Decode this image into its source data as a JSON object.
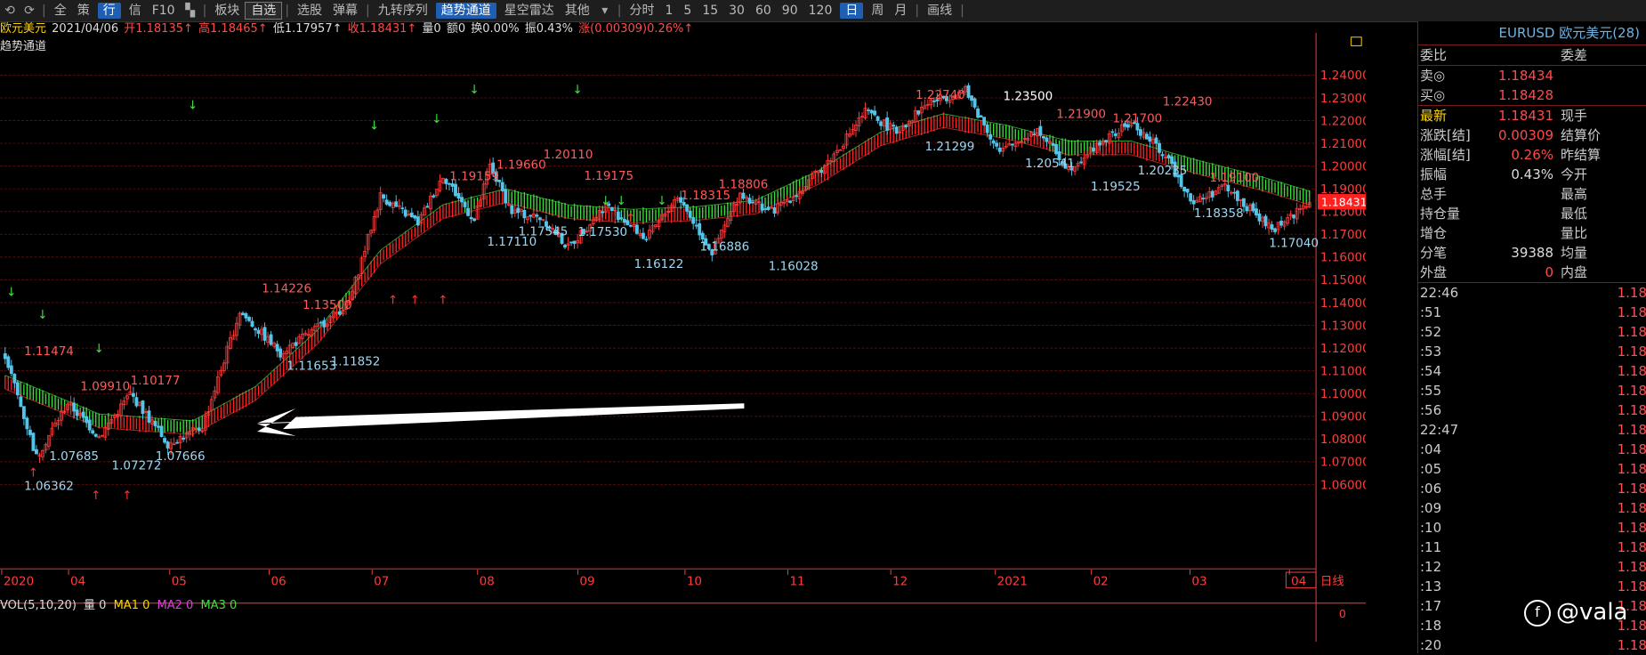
{
  "toolbar": {
    "items": [
      "全",
      "策",
      "行",
      "信",
      "F10",
      "板块",
      "自选",
      "选股",
      "弹幕",
      "九转序列",
      "趋势通道",
      "星空雷达",
      "其他",
      "分时",
      "1",
      "5",
      "15",
      "30",
      "60",
      "90",
      "120",
      "日",
      "周",
      "月",
      "画线"
    ]
  },
  "info": {
    "name": "欧元美元",
    "date": "2021/04/06",
    "open": "开1.18135↑",
    "high": "高1.18465↑",
    "low": "低1.17957↑",
    "close": "收1.18431↑",
    "vol": "量0",
    "amount": "额0",
    "turnover": "换0.00%",
    "amplitude": "振0.43%",
    "change": "涨(0.00309)0.26%↑"
  },
  "indicator_title": "趋势通道",
  "vol_line": {
    "label": "VOL(5,10,20)",
    "vol": "量 0",
    "ma1": "MA1 0",
    "ma2": "MA2 0",
    "ma3": "MA3 0"
  },
  "period_label": "日线",
  "vol_axis_value": "0",
  "colors": {
    "up": "#ff3b3b",
    "down": "#54c4e8",
    "band_up": "#ff2020",
    "band_down": "#38e038",
    "axis": "#ff3b3b",
    "grid": "#5a0d0d",
    "label_blue": "#9fd6f0",
    "label_red": "#ff5a5a"
  },
  "chart_data": {
    "type": "candlestick",
    "symbol": "EURUSD",
    "ylim": [
      1.058,
      1.245
    ],
    "y_ticks": [
      "1.24000",
      "1.23000",
      "1.22000",
      "1.21000",
      "1.20000",
      "1.19000",
      "1.18000",
      "1.17000",
      "1.16000",
      "1.15000",
      "1.14000",
      "1.13000",
      "1.12000",
      "1.11000",
      "1.10000",
      "1.09000",
      "1.08000",
      "1.07000",
      "1.06000"
    ],
    "x_labels": [
      "2020",
      "04",
      "05",
      "06",
      "07",
      "08",
      "09",
      "10",
      "11",
      "12",
      "2021",
      "02",
      "03",
      "04"
    ],
    "last_price": "1.18431",
    "trend_points": [
      [
        0,
        1.117
      ],
      [
        10,
        1.072
      ],
      [
        20,
        1.096
      ],
      [
        30,
        1.081
      ],
      [
        40,
        1.1
      ],
      [
        52,
        1.078
      ],
      [
        63,
        1.085
      ],
      [
        75,
        1.136
      ],
      [
        88,
        1.118
      ],
      [
        100,
        1.129
      ],
      [
        110,
        1.14
      ],
      [
        120,
        1.187
      ],
      [
        132,
        1.175
      ],
      [
        140,
        1.196
      ],
      [
        150,
        1.176
      ],
      [
        155,
        1.2
      ],
      [
        162,
        1.18
      ],
      [
        172,
        1.177
      ],
      [
        180,
        1.164
      ],
      [
        192,
        1.183
      ],
      [
        205,
        1.168
      ],
      [
        215,
        1.187
      ],
      [
        226,
        1.162
      ],
      [
        235,
        1.188
      ],
      [
        245,
        1.18
      ],
      [
        255,
        1.19
      ],
      [
        265,
        1.205
      ],
      [
        275,
        1.224
      ],
      [
        285,
        1.215
      ],
      [
        295,
        1.228
      ],
      [
        307,
        1.233
      ],
      [
        318,
        1.206
      ],
      [
        330,
        1.216
      ],
      [
        340,
        1.199
      ],
      [
        350,
        1.21
      ],
      [
        360,
        1.219
      ],
      [
        370,
        1.206
      ],
      [
        380,
        1.184
      ],
      [
        390,
        1.191
      ],
      [
        405,
        1.172
      ],
      [
        417,
        1.184
      ]
    ],
    "band_points": [
      [
        0,
        1.105
      ],
      [
        30,
        1.088
      ],
      [
        60,
        1.085
      ],
      [
        80,
        1.1
      ],
      [
        100,
        1.125
      ],
      [
        120,
        1.16
      ],
      [
        140,
        1.18
      ],
      [
        160,
        1.187
      ],
      [
        180,
        1.18
      ],
      [
        200,
        1.178
      ],
      [
        220,
        1.179
      ],
      [
        240,
        1.182
      ],
      [
        260,
        1.195
      ],
      [
        280,
        1.212
      ],
      [
        300,
        1.22
      ],
      [
        320,
        1.215
      ],
      [
        340,
        1.208
      ],
      [
        360,
        1.208
      ],
      [
        380,
        1.2
      ],
      [
        400,
        1.193
      ],
      [
        417,
        1.186
      ]
    ],
    "annotations": [
      {
        "text": "1.11474",
        "x": 14,
        "y": 1.1147,
        "color": "red"
      },
      {
        "text": "1.09910",
        "x": 32,
        "y": 1.0991,
        "color": "red"
      },
      {
        "text": "1.10177",
        "x": 48,
        "y": 1.1018,
        "color": "red"
      },
      {
        "text": "1.06362",
        "x": 14,
        "y": 1.0636,
        "color": "blue"
      },
      {
        "text": "1.07685",
        "x": 22,
        "y": 1.0768,
        "color": "blue"
      },
      {
        "text": "1.07272",
        "x": 42,
        "y": 1.0727,
        "color": "blue"
      },
      {
        "text": "1.07666",
        "x": 56,
        "y": 1.0767,
        "color": "blue"
      },
      {
        "text": "1.14226",
        "x": 90,
        "y": 1.1423,
        "color": "red"
      },
      {
        "text": "1.13500",
        "x": 103,
        "y": 1.135,
        "color": "red"
      },
      {
        "text": "1.11653",
        "x": 98,
        "y": 1.1165,
        "color": "blue"
      },
      {
        "text": "1.11852",
        "x": 112,
        "y": 1.1185,
        "color": "blue"
      },
      {
        "text": "1.19159",
        "x": 150,
        "y": 1.1916,
        "color": "red"
      },
      {
        "text": "1.19660",
        "x": 165,
        "y": 1.1966,
        "color": "red"
      },
      {
        "text": "1.20110",
        "x": 180,
        "y": 1.2011,
        "color": "red"
      },
      {
        "text": "1.19175",
        "x": 193,
        "y": 1.1918,
        "color": "red"
      },
      {
        "text": "1.17110",
        "x": 162,
        "y": 1.1711,
        "color": "blue"
      },
      {
        "text": "1.17545",
        "x": 172,
        "y": 1.1755,
        "color": "blue"
      },
      {
        "text": "1.17530",
        "x": 191,
        "y": 1.1753,
        "color": "blue"
      },
      {
        "text": "1.18315",
        "x": 224,
        "y": 1.1832,
        "color": "red"
      },
      {
        "text": "1.18806",
        "x": 236,
        "y": 1.1881,
        "color": "red"
      },
      {
        "text": "1.16122",
        "x": 209,
        "y": 1.1612,
        "color": "blue"
      },
      {
        "text": "1.16886",
        "x": 230,
        "y": 1.1689,
        "color": "blue"
      },
      {
        "text": "1.16028",
        "x": 252,
        "y": 1.1603,
        "color": "blue"
      },
      {
        "text": "1.22740",
        "x": 299,
        "y": 1.2274,
        "color": "red"
      },
      {
        "text": "1.21299",
        "x": 302,
        "y": 1.213,
        "color": "blue"
      },
      {
        "text": "1.23500",
        "x": 327,
        "y": 1.235,
        "color": "white"
      },
      {
        "text": "1.21900",
        "x": 344,
        "y": 1.219,
        "color": "red"
      },
      {
        "text": "1.20541",
        "x": 334,
        "y": 1.2054,
        "color": "blue"
      },
      {
        "text": "1.21700",
        "x": 362,
        "y": 1.217,
        "color": "red"
      },
      {
        "text": "1.19525",
        "x": 355,
        "y": 1.1953,
        "color": "blue"
      },
      {
        "text": "1.20235",
        "x": 370,
        "y": 1.2024,
        "color": "blue"
      },
      {
        "text": "1.22430",
        "x": 378,
        "y": 1.2243,
        "color": "red"
      },
      {
        "text": "1.19100",
        "x": 393,
        "y": 1.191,
        "color": "red"
      },
      {
        "text": "1.18358",
        "x": 388,
        "y": 1.1836,
        "color": "blue"
      },
      {
        "text": "1.17040",
        "x": 412,
        "y": 1.1704,
        "color": "blue"
      }
    ]
  },
  "quote_panel": {
    "header": "EURUSD 欧元美元(28)",
    "rows": [
      {
        "label": "委比",
        "value": "",
        "right": "委差"
      },
      {
        "label": "卖◎",
        "value": "1.18434",
        "right": ""
      },
      {
        "label": "买◎",
        "value": "1.18428",
        "right": ""
      },
      {
        "label": "最新",
        "value": "1.18431",
        "right": "现手"
      },
      {
        "label": "涨跌[结]",
        "value": "0.00309",
        "right": "结算价"
      },
      {
        "label": "涨幅[结]",
        "value": "0.26%",
        "right": "昨结算"
      },
      {
        "label": "振幅",
        "value": "0.43%",
        "right": "今开"
      },
      {
        "label": "总手",
        "value": "",
        "right": "最高"
      },
      {
        "label": "持仓量",
        "value": "",
        "right": "最低"
      },
      {
        "label": "增仓",
        "value": "",
        "right": "量比"
      },
      {
        "label": "分笔",
        "value": "39388",
        "right": "均量"
      },
      {
        "label": "外盘",
        "value": "0",
        "right": "内盘"
      }
    ],
    "ticks": [
      "22:46",
      ":51",
      ":52",
      ":53",
      ":54",
      ":55",
      ":56",
      "22:47",
      ":04",
      ":05",
      ":06",
      ":09",
      ":10",
      ":11",
      ":12",
      ":13",
      ":17",
      ":18",
      ":20"
    ],
    "tick_value": "1.18"
  },
  "watermark": "@vala"
}
